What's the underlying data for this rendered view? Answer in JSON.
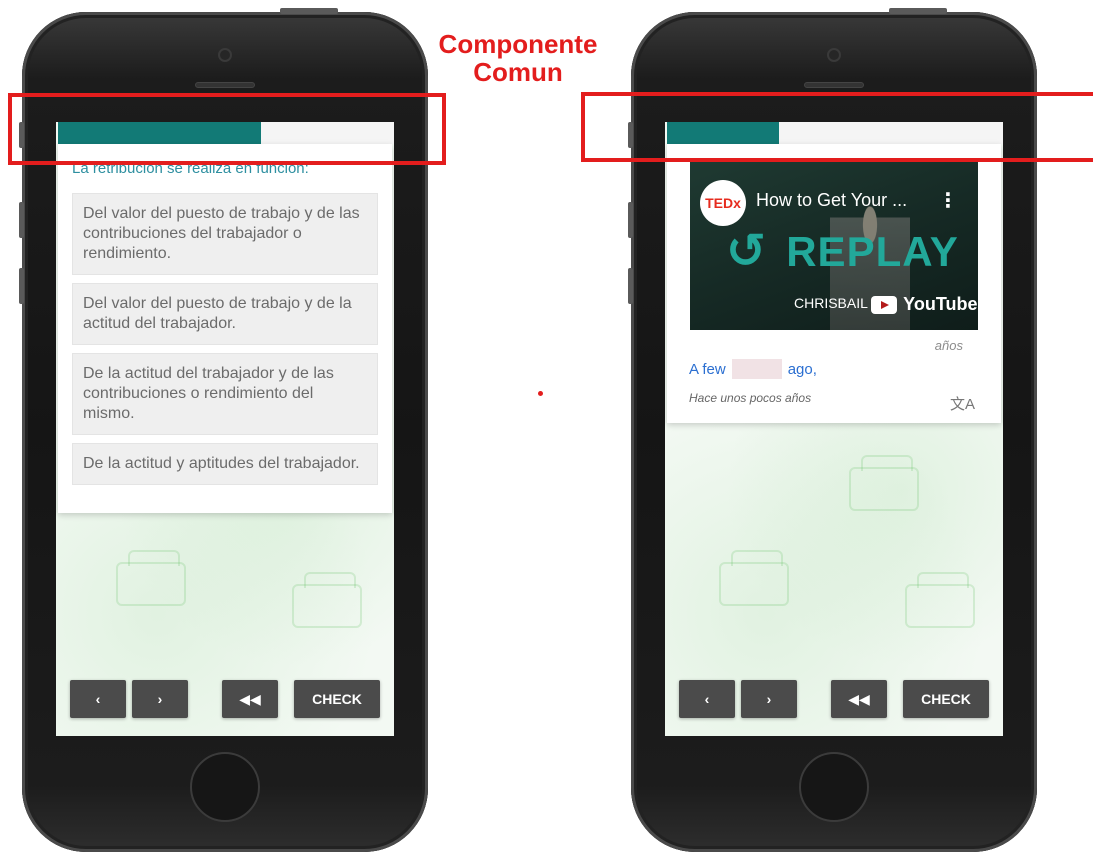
{
  "annotation": {
    "label_line1": "Componente",
    "label_line2": "Comun",
    "color": "#e31d1d"
  },
  "colors": {
    "progress": "#127a76",
    "question_text": "#2e8fa0",
    "check_button": "#4b4b4b",
    "fill_text": "#2b6fd1"
  },
  "left_phone": {
    "progress_fraction": 0.6,
    "question": "La retribución se realiza en función:",
    "options": [
      "Del valor del puesto de trabajo y de las contribuciones del trabajador o rendimiento.",
      "Del valor del puesto de trabajo y de la actitud del trabajador.",
      "De la actitud del trabajador y de las contribuciones o rendimiento del mismo.",
      "De la actitud y aptitudes del trabajador."
    ],
    "controls": {
      "prev": "‹",
      "next": "›",
      "rewind": "◀◀",
      "check": "CHECK"
    }
  },
  "right_phone": {
    "progress_fraction": 0.33,
    "video": {
      "logo": "TEDx",
      "title": "How to Get Your ...",
      "replay_label": "REPLAY",
      "watermark": "CHRISBAIL",
      "brand": "YouTube"
    },
    "hint_word": "años",
    "fill_before": "A few",
    "fill_after": "ago,",
    "translation": "Hace unos pocos años",
    "controls": {
      "prev": "‹",
      "next": "›",
      "rewind": "◀◀",
      "check": "CHECK"
    }
  }
}
